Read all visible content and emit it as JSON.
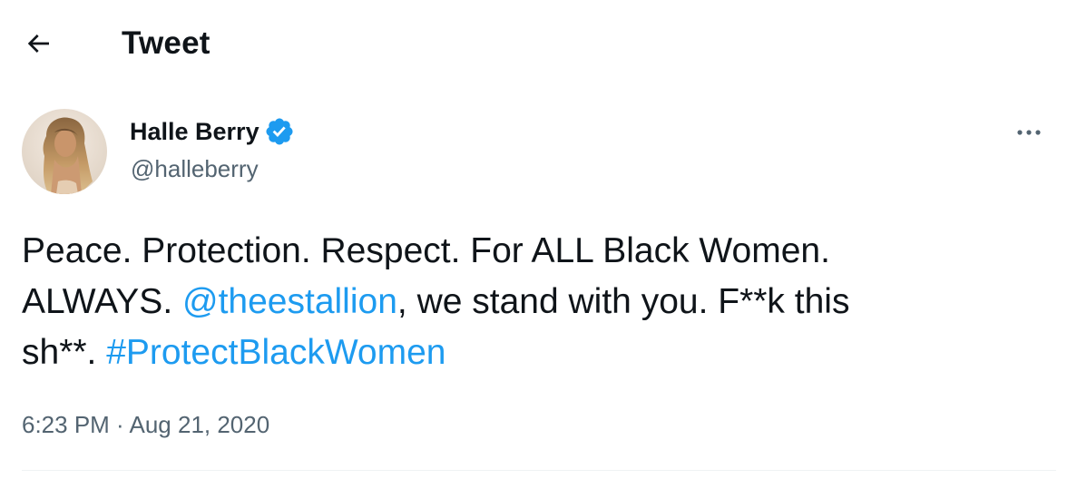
{
  "header": {
    "title": "Tweet",
    "back_icon": "arrow-left-icon"
  },
  "author": {
    "name": "Halle Berry",
    "handle": "@halleberry",
    "verified_icon": "verified-badge-icon",
    "avatar_icon": "avatar-photo"
  },
  "menu": {
    "icon": "more-horizontal-icon"
  },
  "tweet": {
    "line1": "Peace. Protection. Respect. For ALL Black Women.",
    "line2_before": "ALWAYS. ",
    "mention": "@theestallion",
    "line2_after": ", we stand with you. F**k this",
    "line3_before": "sh**. ",
    "hashtag": "#ProtectBlackWomen"
  },
  "meta": {
    "timestamp": "6:23 PM · Aug 21, 2020"
  },
  "colors": {
    "text": "#0f1419",
    "secondary_text": "#536471",
    "link": "#1d9bf0",
    "verified": "#1d9bf0",
    "divider": "#eff3f4"
  }
}
